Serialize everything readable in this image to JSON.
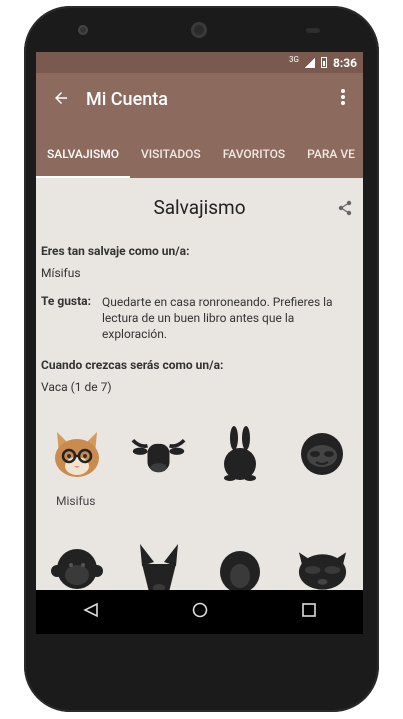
{
  "status": {
    "network": "3G",
    "time": "8:36"
  },
  "appbar": {
    "back_icon": "arrow-left-icon",
    "title": "Mi Cuenta",
    "menu_icon": "more-vert-icon"
  },
  "tabs": [
    {
      "label": "SALVAJISMO",
      "active": true
    },
    {
      "label": "VISITADOS",
      "active": false
    },
    {
      "label": "FAVORITOS",
      "active": false
    },
    {
      "label": "PARA VE",
      "active": false
    }
  ],
  "section": {
    "title": "Salvajismo",
    "share_icon": "share-icon"
  },
  "wild": {
    "question": "Eres tan salvaje como un/a:",
    "answer": "Mísifus"
  },
  "likes": {
    "label": "Te gusta:",
    "text": "Quedarte en casa ronroneando. Prefieres la lectura de un buen libro antes que la exploración."
  },
  "future": {
    "question": "Cuando crezcas serás como un/a:",
    "answer": "Vaca (1 de 7)"
  },
  "animals": {
    "row1": [
      "cat-with-glasses",
      "cow",
      "rabbit",
      "sloth"
    ],
    "row2": [
      "monkey",
      "dog",
      "penguin",
      "raccoon"
    ],
    "selected_name": "Misifus"
  },
  "colors": {
    "appbar": "#8c6b5e",
    "statusbar": "#7a5a4e",
    "background": "#e9e5e1"
  }
}
